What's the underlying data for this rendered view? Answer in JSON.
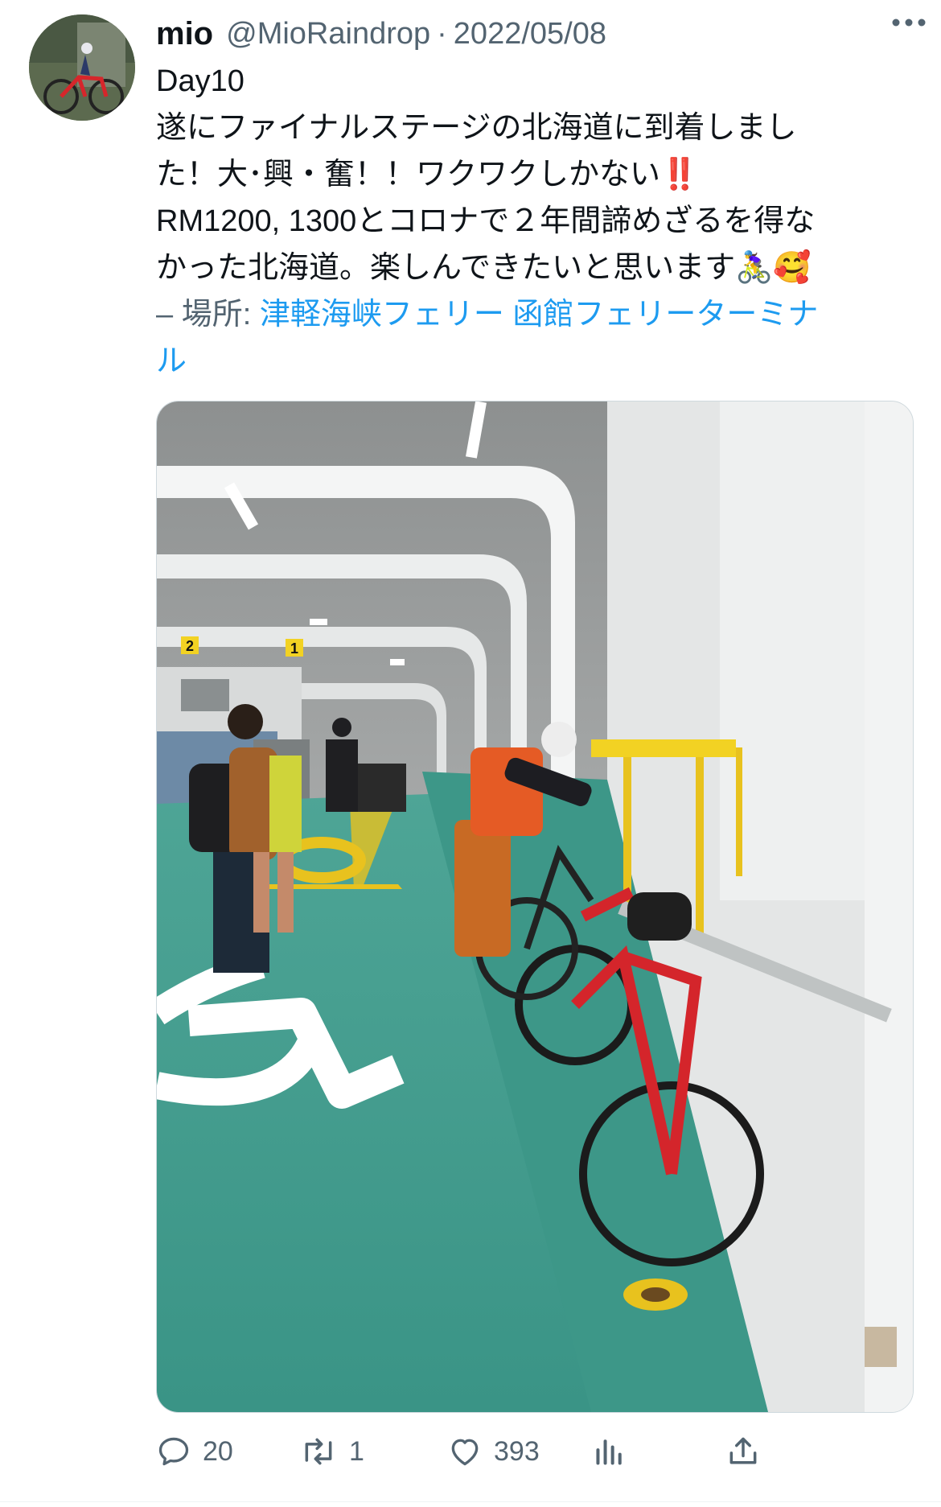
{
  "tweet": {
    "author_name": "mio",
    "handle": "@MioRaindrop",
    "separator": "·",
    "date": "2022/05/08",
    "text_lines": [
      "Day10",
      "遂にファイナルステージの北海道に到着しまし",
      "た！大･興・奮！！ワクワクしかない‼️",
      "RM1200, 1300とコロナで２年間諦めざるを得な",
      "かった北海道。楽しんできたいと思います🚴‍♀️🥰"
    ],
    "location_prefix": "– 場所: ",
    "location_line1": "津軽海峡フェリー 函館フェリーターミナ",
    "location_line2": "ル"
  },
  "actions": {
    "replies": "20",
    "retweets": "1",
    "likes": "393"
  },
  "icons": {
    "more": "more-horizontal-icon",
    "reply": "reply-icon",
    "retweet": "retweet-icon",
    "like": "heart-icon",
    "views": "views-icon",
    "share": "share-icon"
  },
  "colors": {
    "text": "#0f1419",
    "secondary": "#536471",
    "link": "#1d9bf0",
    "floor": "#3f9a8c",
    "floor_marking_yellow": "#e8c21e"
  }
}
